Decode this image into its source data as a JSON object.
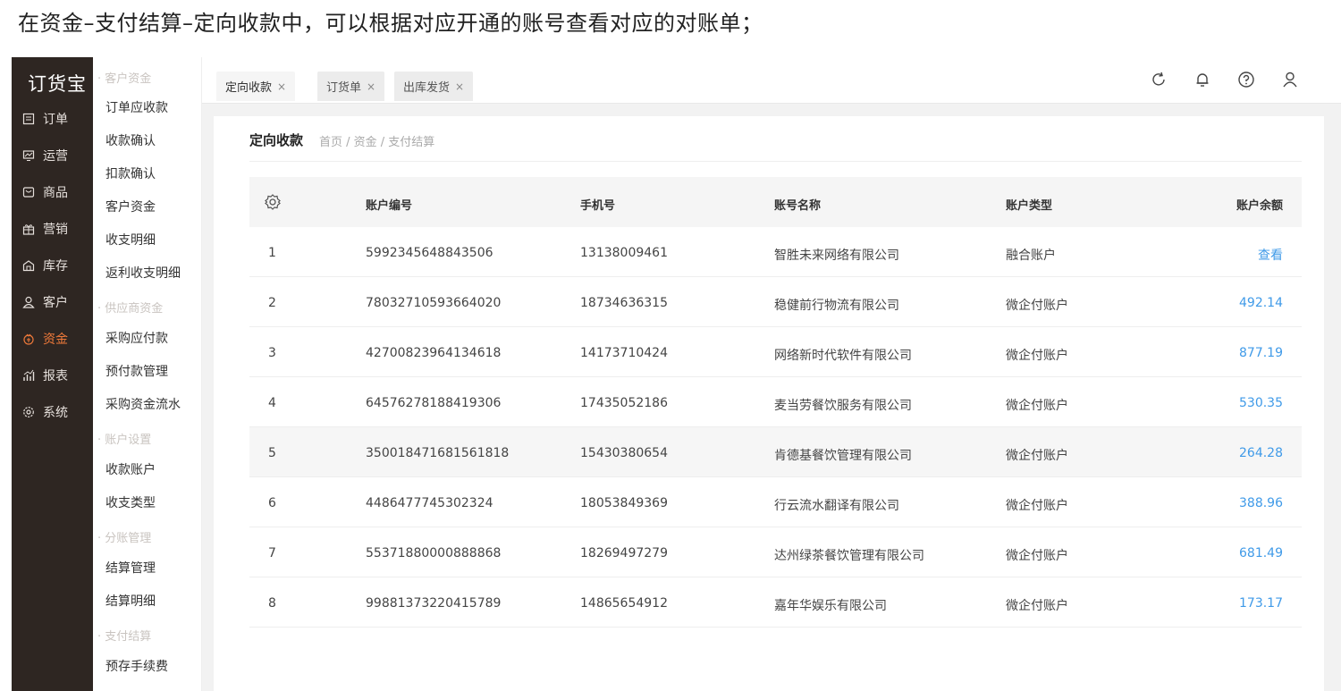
{
  "caption": "在资金–支付结算–定向收款中，可以根据对应开通的账号查看对应的对账单；",
  "logo": "订货宝",
  "nav": [
    {
      "label": "订单",
      "icon": "order-icon"
    },
    {
      "label": "运营",
      "icon": "operation-icon"
    },
    {
      "label": "商品",
      "icon": "product-icon"
    },
    {
      "label": "营销",
      "icon": "marketing-gift-icon"
    },
    {
      "label": "库存",
      "icon": "warehouse-icon"
    },
    {
      "label": "客户",
      "icon": "customer-icon"
    },
    {
      "label": "资金",
      "icon": "funds-icon",
      "active": true
    },
    {
      "label": "报表",
      "icon": "report-chart-icon"
    },
    {
      "label": "系统",
      "icon": "settings-gear-icon"
    }
  ],
  "subnav": {
    "groups": [
      "客户资金",
      "供应商资金",
      "账户设置",
      "分账管理",
      "支付结算"
    ],
    "items": [
      "订单应收款",
      "收款确认",
      "扣款确认",
      "客户资金",
      "收支明细",
      "返利收支明细",
      "采购应付款",
      "预付款管理",
      "采购资金流水",
      "收款账户",
      "收支类型",
      "结算管理",
      "结算明细",
      "预存手续费"
    ]
  },
  "tabs": [
    "定向收款",
    "订货单",
    "出库发货"
  ],
  "tab_close": "×",
  "tools": [
    "refresh-icon",
    "bell-icon",
    "help-icon",
    "user-icon"
  ],
  "page": {
    "title": "定向收款",
    "breadcrumb": "首页 / 资金 / 支付结算"
  },
  "table": {
    "settings_icon": "table-settings-icon",
    "headers": [
      "账户编号",
      "手机号",
      "账号名称",
      "账户类型",
      "账户余额"
    ],
    "rows": [
      {
        "no": "1",
        "account": "5992345648843506",
        "phone": "13138009461",
        "name": "智胜未来网络有限公司",
        "type": "融合账户",
        "balance": "查看"
      },
      {
        "no": "2",
        "account": "78032710593664020",
        "phone": "18734636315",
        "name": "稳健前行物流有限公司",
        "type": "微企付账户",
        "balance": "492.14"
      },
      {
        "no": "3",
        "account": "42700823964134618",
        "phone": "14173710424",
        "name": "网络新时代软件有限公司",
        "type": "微企付账户",
        "balance": "877.19"
      },
      {
        "no": "4",
        "account": "64576278188419306",
        "phone": "17435052186",
        "name": "麦当劳餐饮服务有限公司",
        "type": "微企付账户",
        "balance": "530.35"
      },
      {
        "no": "5",
        "account": "350018471681561818",
        "phone": "15430380654",
        "name": "肯德基餐饮管理有限公司",
        "type": "微企付账户",
        "balance": "264.28"
      },
      {
        "no": "6",
        "account": "4486477745302324",
        "phone": "18053849369",
        "name": "行云流水翻译有限公司",
        "type": "微企付账户",
        "balance": "388.96"
      },
      {
        "no": "7",
        "account": "55371880000888868",
        "phone": "18269497279",
        "name": "达州绿茶餐饮管理有限公司",
        "type": "微企付账户",
        "balance": "681.49"
      },
      {
        "no": "8",
        "account": "99881373220415789",
        "phone": "14865654912",
        "name": "嘉年华娱乐有限公司",
        "type": "微企付账户",
        "balance": "173.17"
      }
    ]
  },
  "colors": {
    "sidebar": "#2e2622",
    "active_nav": "#f07a3a",
    "link": "#3f9ae8"
  }
}
